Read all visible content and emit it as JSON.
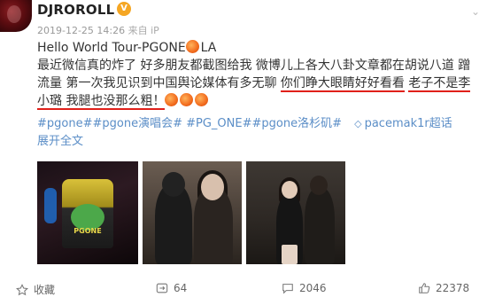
{
  "post": {
    "username": "DJROROLL",
    "badge": "V",
    "meta": {
      "timestamp": "2019-12-25 14:26",
      "source": "来自 iP"
    },
    "lines": [
      "Hello World Tour-PGONE",
      "最近微信真的炸了 好多朋友都截图给我 微博儿上各大八卦文章都在胡说八道 蹭",
      "流量 第一次我见识到中国舆论媒体有多无聊 ",
      "小璐 我腿也没那么粗！"
    ],
    "line1_suffix": "LA",
    "line3_highlight_a": "你们睁大眼睛好好看看",
    "line3_highlight_b": "老子不是李",
    "tags": {
      "items": [
        "#pgone##pgone演唱会#",
        "#PG_ONE##pgone洛杉矶#"
      ],
      "super_topic": "pacemak1r超话"
    },
    "expand_label": "展开全文",
    "photos": [
      {
        "alt_icon": "trophy-cup",
        "label": "PGONE"
      },
      {
        "alt_icon": "people",
        "label": ""
      },
      {
        "alt_icon": "people",
        "label": ""
      }
    ]
  },
  "actions": {
    "favorite": {
      "label": "收藏",
      "icon": "star-icon"
    },
    "repost": {
      "count": "64",
      "icon": "repost-icon"
    },
    "comment": {
      "count": "2046",
      "icon": "comment-icon"
    },
    "like": {
      "count": "22378",
      "icon": "thumbs-up-icon"
    }
  },
  "colors": {
    "link": "#5b8ec7",
    "highlight_underline": "#e0201a",
    "text": "#333333",
    "meta": "#999999"
  }
}
